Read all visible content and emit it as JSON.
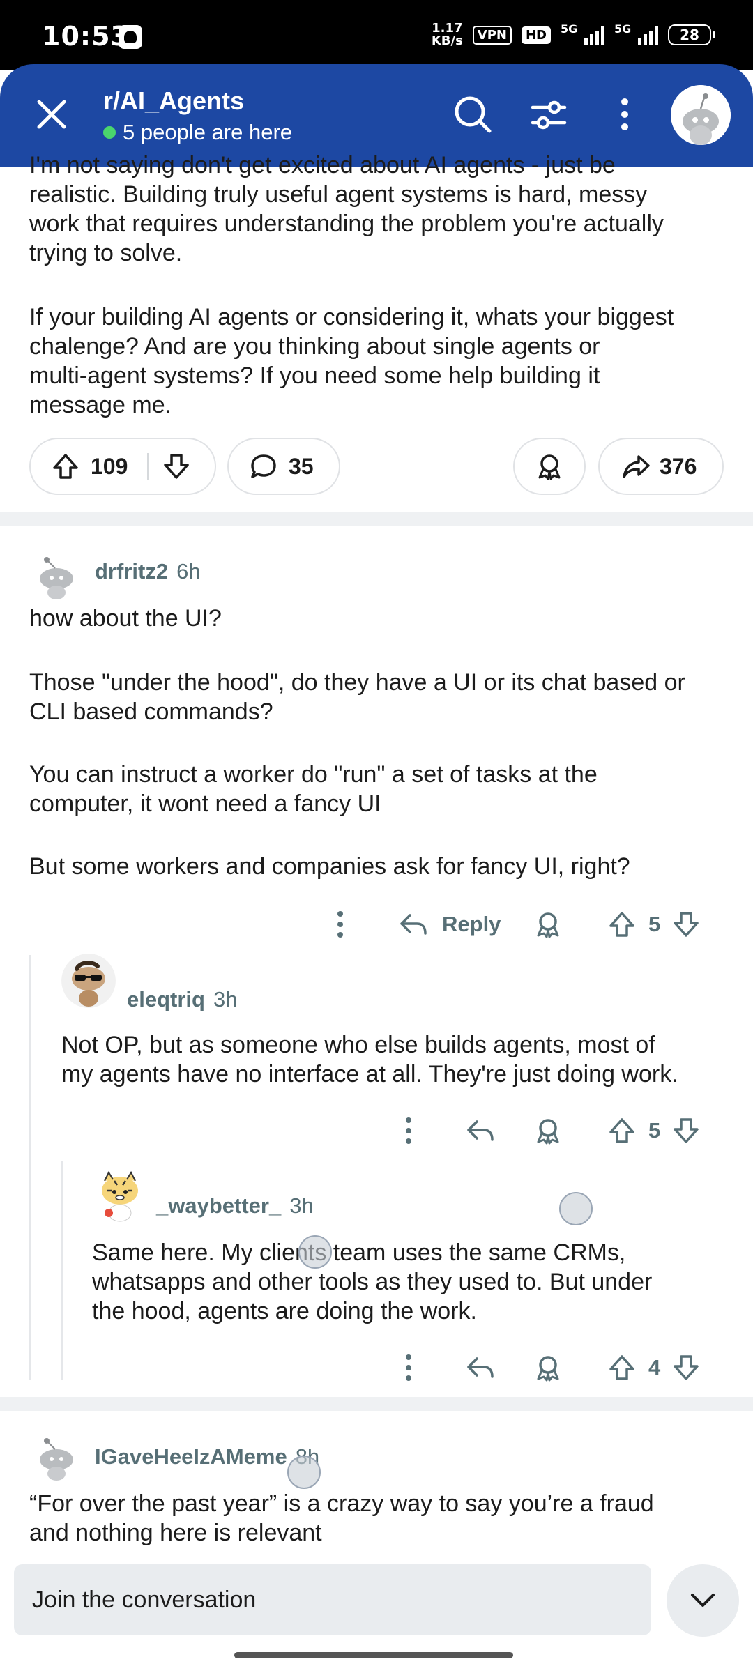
{
  "status_bar": {
    "time": "10:53",
    "net_speed_value": "1.17",
    "net_speed_unit": "KB/s",
    "vpn": "VPN",
    "hd": "HD",
    "sig1": "5G",
    "sig2": "5G",
    "battery": "28"
  },
  "header": {
    "title": "r/AI_Agents",
    "presence": "5 people are here"
  },
  "post": {
    "paragraph1_clipped": "I'm not saying don't get excited about AI agents - just be",
    "paragraph1": [
      "realistic. Building truly useful agent systems is hard, messy",
      "work that requires understanding the problem you're actually",
      "trying to solve."
    ],
    "paragraph2": [
      "If your building AI agents or considering it, whats your biggest",
      "chalenge? And are you thinking about single agents or",
      "multi-agent systems? If you need some help building it",
      "message me."
    ],
    "upvotes": "109",
    "comments": "35",
    "shares": "376"
  },
  "comments": [
    {
      "username": "drfritz2",
      "time": "6h",
      "lines": [
        "how about the UI?",
        "",
        "Those \"under the hood\", do they have a UI or its chat based or",
        "CLI based commands?",
        "",
        "You can instruct a worker do \"run\" a set of tasks at the",
        "computer, it wont need a fancy UI",
        "",
        "But some workers and companies ask for fancy UI, right?"
      ],
      "reply_label": "Reply",
      "votes": "5"
    },
    {
      "username": "eleqtriq",
      "time": "3h",
      "lines": [
        "Not OP, but as someone who else builds agents, most of",
        "my agents have no interface at all. They're just doing work."
      ],
      "votes": "5"
    },
    {
      "username": "_waybetter_",
      "time": "3h",
      "lines": [
        "Same here. My clients team uses the same CRMs,",
        "whatsapps and other tools as they used to. But under",
        "the hood, agents are doing the work."
      ],
      "votes": "4"
    },
    {
      "username": "IGaveHeelzAMeme",
      "time": "8h",
      "lines": [
        "“For over the past year” is a crazy way to say you’re a fraud",
        "and nothing here is relevant"
      ]
    }
  ],
  "bottom": {
    "placeholder": "Join the conversation"
  },
  "colors": {
    "header_bg": "#1d48a3",
    "meta_text": "#576f76",
    "band": "#eff1f3"
  }
}
